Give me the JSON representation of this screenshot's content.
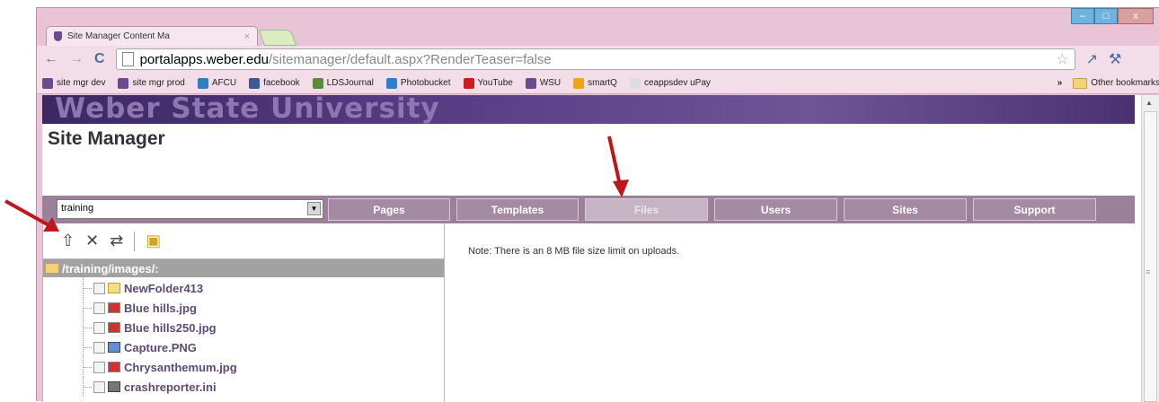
{
  "browser": {
    "tab_title": "Site Manager Content Ma",
    "tab_close": "×",
    "url_host": "portalapps.weber.edu",
    "url_path": "/sitemanager/default.aspx?RenderTeaser=false",
    "window_controls": [
      "–",
      "□",
      "x"
    ]
  },
  "bookmarks": [
    {
      "label": "site mgr dev",
      "icon": "shield-icon",
      "color": "#6b4a8d"
    },
    {
      "label": "site mgr prod",
      "icon": "shield-icon",
      "color": "#6b4a8d"
    },
    {
      "label": "AFCU",
      "icon": "afcu-icon",
      "color": "#2d7fbf"
    },
    {
      "label": "facebook",
      "icon": "facebook-icon",
      "color": "#3b5998"
    },
    {
      "label": "LDSJournal",
      "icon": "quill-icon",
      "color": "#5a8a3a"
    },
    {
      "label": "Photobucket",
      "icon": "photobucket-icon",
      "color": "#2a7fcf"
    },
    {
      "label": "YouTube",
      "icon": "youtube-icon",
      "color": "#cc1d1d"
    },
    {
      "label": "WSU",
      "icon": "shield-icon",
      "color": "#6b4a8d"
    },
    {
      "label": "smartQ",
      "icon": "smartq-icon",
      "color": "#f0a11e"
    },
    {
      "label": "ceappsdev uPay",
      "icon": "page-icon",
      "color": "#dddddd"
    }
  ],
  "bookmarks_overflow": "»",
  "other_bookmarks": "Other bookmarks",
  "banner_text": "Weber State University",
  "page_title": "Site Manager",
  "site_select": {
    "value": "training"
  },
  "nav_tabs": [
    "Pages",
    "Templates",
    "Files",
    "Users",
    "Sites",
    "Support"
  ],
  "active_tab": "Files",
  "file_path": "/training/images/:",
  "files": [
    {
      "name": "NewFolder413",
      "type": "folder"
    },
    {
      "name": "Blue hills.jpg",
      "type": "image"
    },
    {
      "name": "Blue hills250.jpg",
      "type": "image"
    },
    {
      "name": "Capture.PNG",
      "type": "png"
    },
    {
      "name": "Chrysanthemum.jpg",
      "type": "image"
    },
    {
      "name": "crashreporter.ini",
      "type": "ini"
    }
  ],
  "note": "Note: There is an 8 MB file size limit on uploads.",
  "colors": {
    "banner": "#4a3272",
    "nav": "#9a8099",
    "arrow": "#c0161b"
  }
}
